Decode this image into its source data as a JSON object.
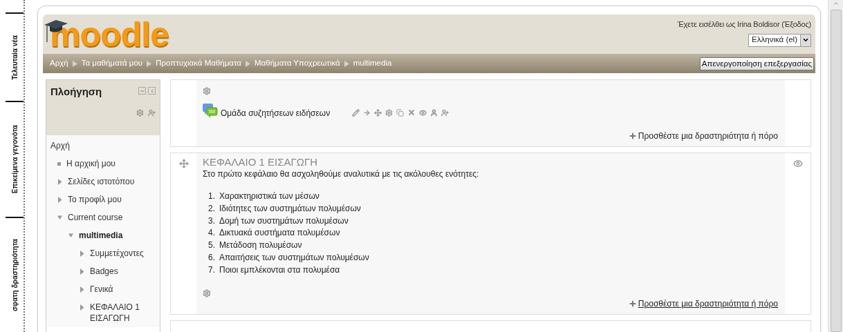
{
  "side_tabs": [
    {
      "label": "Τελευταία νέα"
    },
    {
      "label": "Επικείμενα γεγονότα"
    },
    {
      "label": "σφατη δραστηριότητα"
    }
  ],
  "header": {
    "logo": "moodle",
    "login_text": "Έχετε εισέλθει ως Irina Boldisor (Έξοδος)",
    "language": "Ελληνικά (el)",
    "breadcrumbs": [
      "Αρχή",
      "Τα μαθήματά μου",
      "Προπτυχιακά Μαθήματα",
      "Μαθήματα Υποχρεωτικά",
      "multimedia"
    ],
    "edit_button": "Απενεργοποίηση επεξεργασίας"
  },
  "navigation": {
    "title": "Πλοήγηση",
    "items": [
      {
        "label": "Αρχή",
        "kind": "root",
        "children": [
          {
            "label": "Η αρχική μου",
            "kind": "leaf"
          },
          {
            "label": "Σελίδες ιστοτόπου",
            "kind": "branch",
            "expanded": false
          },
          {
            "label": "Το προφίλ μου",
            "kind": "branch",
            "expanded": false
          },
          {
            "label": "Current course",
            "kind": "branch",
            "expanded": true,
            "children": [
              {
                "label": "multimedia",
                "kind": "course",
                "expanded": true,
                "children": [
                  {
                    "label": "Συμμετέχοντες",
                    "kind": "branch",
                    "expanded": false
                  },
                  {
                    "label": "Badges",
                    "kind": "branch",
                    "expanded": false
                  },
                  {
                    "label": "Γενικά",
                    "kind": "branch",
                    "expanded": false
                  },
                  {
                    "label": "ΚΕΦΑΛΑΙΟ 1 ΕΙΣΑΓΩΓΗ",
                    "kind": "branch",
                    "expanded": false
                  }
                ]
              }
            ]
          }
        ]
      }
    ]
  },
  "sections": [
    {
      "kind": "intro",
      "activities": [
        {
          "name": "Ομάδα συζητήσεων ειδήσεων",
          "kind": "forum"
        }
      ],
      "add_link": {
        "label": "Προσθέστε μια δραστηριότητα ή πόρο",
        "hovered": false
      }
    },
    {
      "kind": "topic",
      "title": "ΚΕΦΑΛΑΙΟ 1 ΕΙΣΑΓΩΓΗ",
      "summary": "Στο πρώτο κεφάλαιο θα ασχοληθούμε αναλυτικά με τις ακόλουθες ενότητες:",
      "list": [
        {
          "number": "1.",
          "text": "Χαρακτηριστικά των μέσων"
        },
        {
          "number": "2.",
          "text": "Ιδιότητες των συστημάτων πολυμέσων"
        },
        {
          "number": "3.",
          "text": "Δομή των συστημάτων πολυμέσων"
        },
        {
          "number": "4.",
          "text": "Δικτυακά συστήματα πολυμέσων"
        },
        {
          "number": "5.",
          "text": "Μετάδοση πολυμέσων"
        },
        {
          "number": "6.",
          "text": "Απαιτήσεις των συστημάτων πολυμέσων"
        },
        {
          "number": "7.",
          "text": "Ποιοι εμπλέκονται στα πολυμέσα"
        }
      ],
      "add_link": {
        "label": "Προσθέστε μια δραστηριότητα ή πόρο",
        "hovered": true
      }
    },
    {
      "kind": "topic_cut"
    }
  ]
}
